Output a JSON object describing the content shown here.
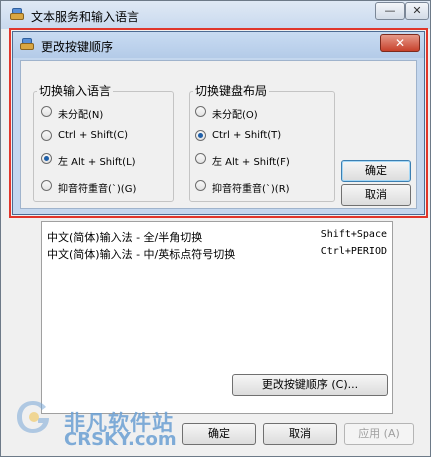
{
  "outer_window": {
    "title": "文本服务和输入语言",
    "titlebar_buttons": [
      "—",
      "✕"
    ],
    "ime_rows": [
      {
        "label": "中文(简体)输入法 - 全/半角切换",
        "hotkey": "Shift+Space"
      },
      {
        "label": "中文(简体)输入法 - 中/英标点符号切换",
        "hotkey": "Ctrl+PERIOD"
      }
    ],
    "change_sequence_button": "更改按键顺序 (C)...",
    "ok_button": "确定",
    "cancel_button": "取消",
    "apply_button": "应用 (A)"
  },
  "dialog": {
    "title": "更改按键顺序",
    "close_icon_glyph": "✕",
    "input_language_group": {
      "legend": "切换输入语言",
      "options": [
        "未分配(N)",
        "Ctrl + Shift(C)",
        "左 Alt + Shift(L)",
        "抑音符重音(`)(G)"
      ],
      "selected": 2
    },
    "keyboard_layout_group": {
      "legend": "切换键盘布局",
      "options": [
        "未分配(O)",
        "Ctrl + Shift(T)",
        "左 Alt + Shift(F)",
        "抑音符重音(`)(R)"
      ],
      "selected": 1
    },
    "ok_button": "确定",
    "cancel_button": "取消"
  },
  "watermark": {
    "line1": "非凡软件站",
    "line2": "CRSKY.com"
  },
  "colors": {
    "highlight_border": "#e0362b",
    "close_button": "#c7412b",
    "titlebar": "#c8dbf2"
  }
}
